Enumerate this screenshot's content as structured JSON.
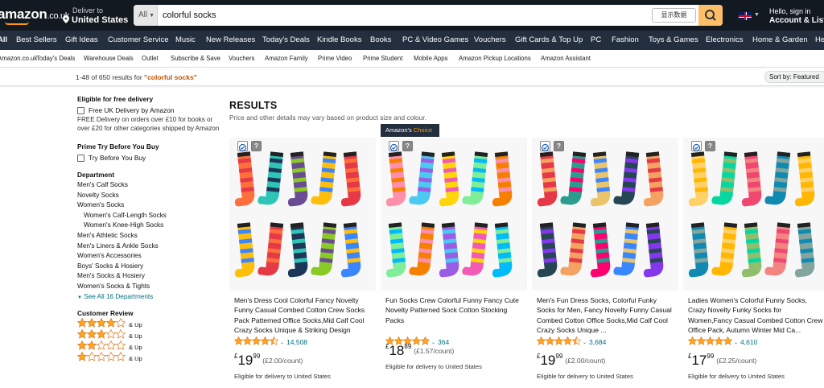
{
  "header": {
    "logo": "amazon",
    "logo_tld": ".co.uk",
    "deliver_line1": "Deliver to",
    "deliver_line2": "United States",
    "search": {
      "category": "All",
      "query": "colorful socks",
      "ime_label": "显示数据"
    },
    "account_line1": "Hello, sign in",
    "account_line2": "Account & Lists"
  },
  "nav_main": [
    "All",
    "Best Sellers",
    "Gift Ideas",
    "Customer Service",
    "Music",
    "New Releases",
    "Today's Deals",
    "Kindle Books",
    "Books",
    "PC & Video Games",
    "Vouchers",
    "Gift Cards & Top Up",
    "PC",
    "Fashion",
    "Toys & Games",
    "Electronics",
    "Home & Garden",
    "He"
  ],
  "nav_sub": [
    "Amazon.co.uk",
    "Today's Deals",
    "Warehouse Deals",
    "Outlet",
    "Subscribe & Save",
    "Vouchers",
    "Amazon Family",
    "Prime Video",
    "Prime Student",
    "Mobile Apps",
    "Amazon Pickup Locations",
    "Amazon Assistant"
  ],
  "results_bar": {
    "count_text": "1-48 of 650 results for ",
    "query_quoted": "\"colorful socks\"",
    "sort_label": "Sort by:",
    "sort_value": "Featured"
  },
  "sidebar": {
    "free_delivery_heading": "Eligible for free delivery",
    "free_delivery_option": "Free UK Delivery by Amazon",
    "free_delivery_note": "FREE Delivery on orders over £10 for books or over £20 for other categories shipped by Amazon",
    "prime_heading": "Prime Try Before You Buy",
    "prime_option": "Try Before You Buy",
    "department_heading": "Department",
    "departments": [
      {
        "label": "Men's Calf Socks",
        "sub": false
      },
      {
        "label": "Novelty Socks",
        "sub": false
      },
      {
        "label": "Women's Socks",
        "sub": false
      },
      {
        "label": "Women's Calf-Length Socks",
        "sub": true
      },
      {
        "label": "Women's Knee-High Socks",
        "sub": true
      },
      {
        "label": "Men's Athletic Socks",
        "sub": false
      },
      {
        "label": "Men's Liners & Ankle Socks",
        "sub": false
      },
      {
        "label": "Women's Accessories",
        "sub": false
      },
      {
        "label": "Boys' Socks & Hosiery",
        "sub": false
      },
      {
        "label": "Men's Socks & Hosiery",
        "sub": false
      },
      {
        "label": "Women's Socks & Tights",
        "sub": false
      }
    ],
    "see_all": "See All 16 Departments",
    "review_heading": "Customer Review",
    "review_filters": [
      {
        "stars": 4,
        "label": "& Up"
      },
      {
        "stars": 3,
        "label": "& Up"
      },
      {
        "stars": 2,
        "label": "& Up"
      },
      {
        "stars": 1,
        "label": "& Up"
      }
    ]
  },
  "results": {
    "heading": "RESULTS",
    "subheading": "Price and other details may vary based on product size and colour.",
    "products": [
      {
        "badge": "",
        "title": "Men's Dress Cool Colorful Fancy Novelty Funny Casual Combed Cotton Crew Socks Pack Patterned Office Socks,Mid Calf Cool Crazy Socks Unique & Striking Design",
        "rating": 4.5,
        "reviews": "14,508",
        "currency": "£",
        "price_whole": "19",
        "price_fraction": "99",
        "unit_price": "(£2.00/count)",
        "delivery": "Eligible for delivery to United States"
      },
      {
        "badge": "Amazon's Choice",
        "title": "Fun Socks Crew Colorful Funny Fancy Cute Novelty Patterned Sock Cotton Stocking Packs",
        "rating": 5,
        "reviews": "364",
        "currency": "£",
        "price_whole": "18",
        "price_fraction": "89",
        "unit_price": "(£1.57/count)",
        "delivery": "Eligible for delivery to United States"
      },
      {
        "badge": "",
        "title": "Men's Fun Dress Socks, Colorful Funky Socks for Men, Fancy Novelty Funny Casual Combed Cotton Office Socks,Mid Calf Cool Crazy Socks Unique ...",
        "rating": 4.5,
        "reviews": "3,684",
        "currency": "£",
        "price_whole": "19",
        "price_fraction": "99",
        "unit_price": "(£2.00/count)",
        "delivery": "Eligible for delivery to United States"
      },
      {
        "badge": "",
        "title": "Ladies Women's Colorful Funny Socks, Crazy Novelty Funky Socks for Women,Fancy Casual Combed Cotton Crew Office Pack, Autumn Winter Mid Ca...",
        "rating": 5,
        "reviews": "4,610",
        "currency": "£",
        "price_whole": "17",
        "price_fraction": "99",
        "unit_price": "(£2.25/count)",
        "delivery": "Eligible for delivery to United States"
      }
    ]
  },
  "colors": {
    "nav": "#131921",
    "nav2": "#232f3e",
    "search_btn": "#febd69",
    "link": "#007185",
    "star": "#ffa41c",
    "query": "#c45500"
  }
}
